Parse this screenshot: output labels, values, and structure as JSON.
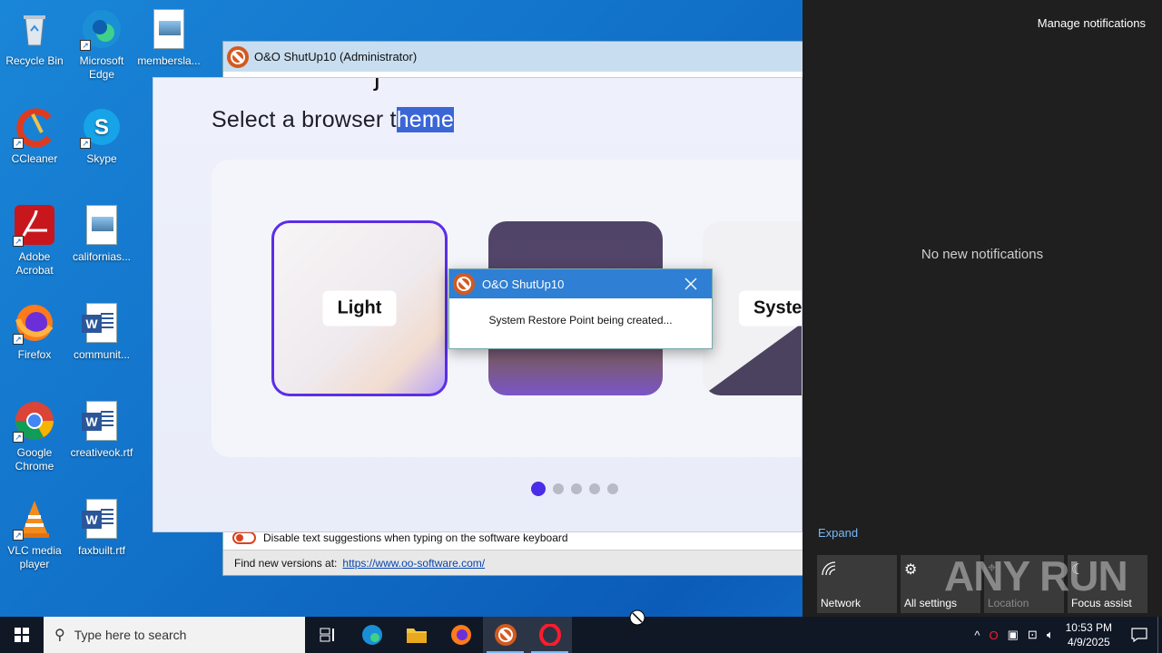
{
  "desktop": {
    "icons": [
      {
        "label": "Recycle Bin"
      },
      {
        "label": "Microsoft Edge"
      },
      {
        "label": "membersla..."
      },
      {
        "label": "CCleaner"
      },
      {
        "label": "Skype"
      },
      {
        "label": "Adobe Acrobat"
      },
      {
        "label": "californias..."
      },
      {
        "label": "Firefox"
      },
      {
        "label": "communit..."
      },
      {
        "label": "Google Chrome"
      },
      {
        "label": "creativeok.rtf"
      },
      {
        "label": "VLC media player"
      },
      {
        "label": "faxbuilt.rtf"
      }
    ]
  },
  "shutup": {
    "title": "O&O ShutUp10 (Administrator)",
    "setting_label": "Disable text suggestions when typing on the software keyboard",
    "footer_text": "Find new versions at:",
    "footer_link": "https://www.oo-software.com/"
  },
  "opera_setup": {
    "heading_pre": "Select a browser t",
    "heading_sel": "heme",
    "themes": [
      {
        "label": "Light",
        "selected": true
      },
      {
        "label": "",
        "selected": false
      },
      {
        "label": "Syste",
        "selected": false
      }
    ],
    "pagination": {
      "total": 5,
      "active": 1
    }
  },
  "dialog": {
    "title": "O&O ShutUp10",
    "message": "System Restore Point being created..."
  },
  "action_center": {
    "manage": "Manage notifications",
    "empty": "No new notifications",
    "expand": "Expand",
    "tiles": [
      {
        "label": "Network",
        "icon": "network-icon"
      },
      {
        "label": "All settings",
        "icon": "gear-icon"
      },
      {
        "label": "Location",
        "icon": "location-icon"
      },
      {
        "label": "Focus assist",
        "icon": "moon-icon"
      }
    ],
    "watermark": "ANY RUN"
  },
  "taskbar": {
    "search_placeholder": "Type here to search",
    "time": "10:53 PM",
    "date": "4/9/2025"
  },
  "colors": {
    "accent_purple": "#5a2ee8",
    "dialog_title": "#2f7fd4",
    "action_bg": "#1f1f1f"
  }
}
